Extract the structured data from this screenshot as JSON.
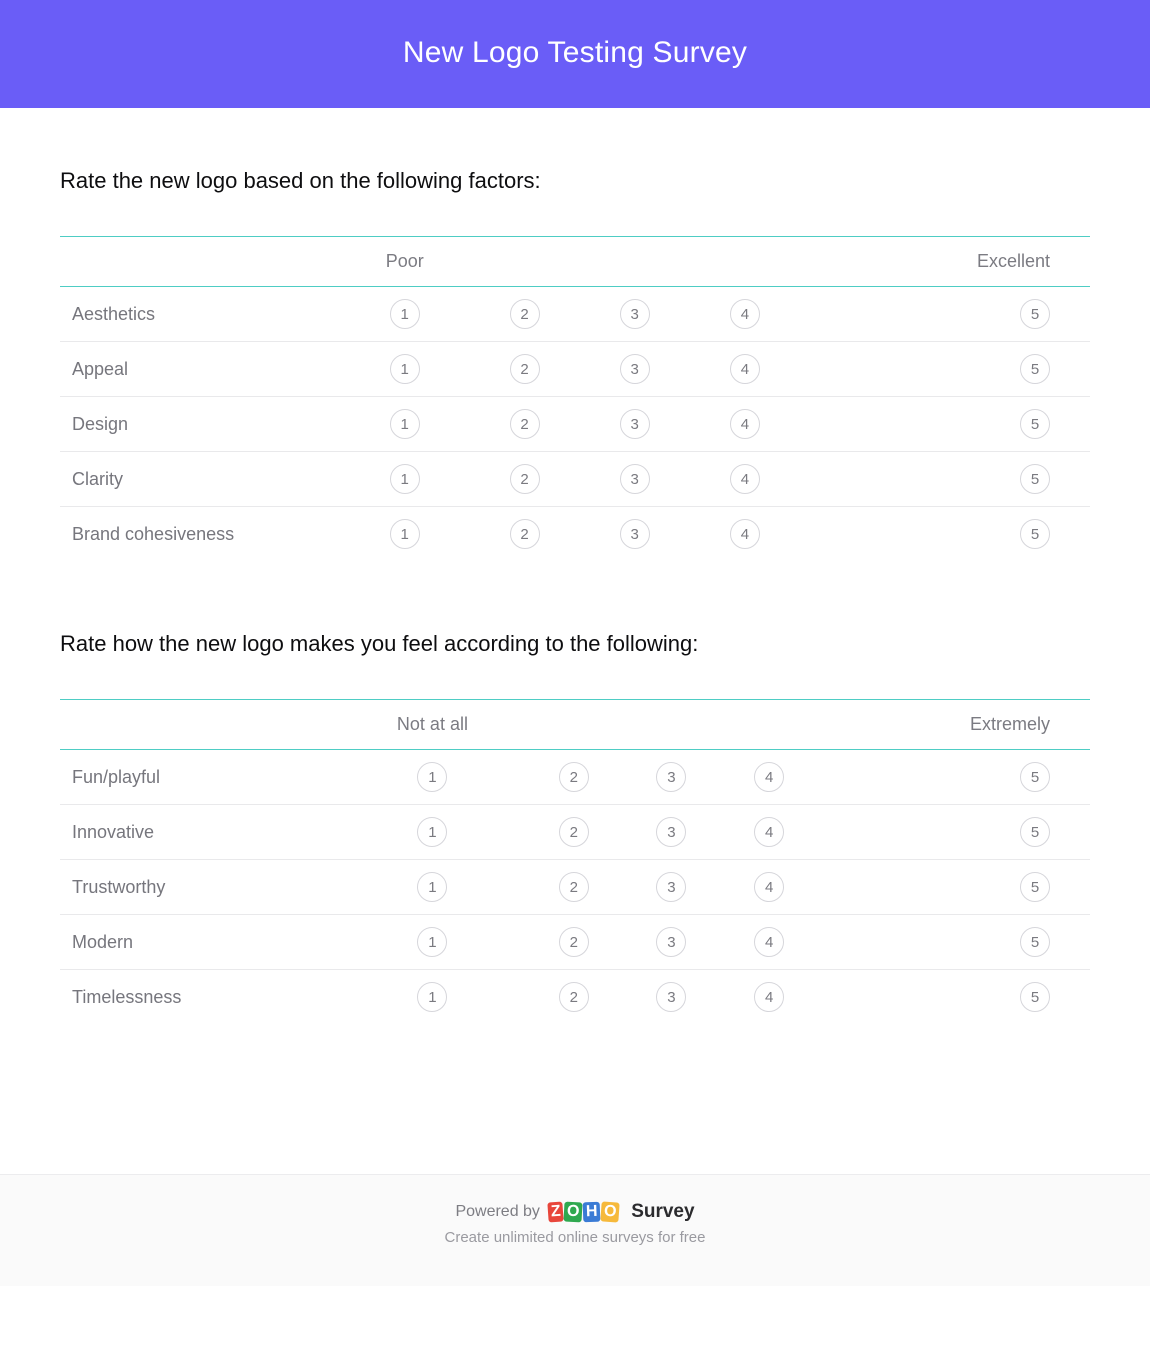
{
  "header": {
    "title": "New Logo Testing Survey"
  },
  "questions": [
    {
      "prompt": "Rate the new logo based on the following factors:",
      "scale_low": "Poor",
      "scale_high": "Excellent",
      "rows": [
        "Aesthetics",
        "Appeal",
        "Design",
        "Clarity",
        "Brand cohesiveness"
      ],
      "options": [
        "1",
        "2",
        "3",
        "4",
        "5"
      ]
    },
    {
      "prompt": "Rate how the new logo makes you feel according to the following:",
      "scale_low": "Not at all",
      "scale_high": "Extremely",
      "rows": [
        "Fun/playful",
        "Innovative",
        "Trustworthy",
        "Modern",
        "Timelessness"
      ],
      "options": [
        "1",
        "2",
        "3",
        "4",
        "5"
      ]
    }
  ],
  "footer": {
    "powered_by": "Powered by",
    "brand_word": "Survey",
    "tagline": "Create unlimited online surveys for free"
  }
}
